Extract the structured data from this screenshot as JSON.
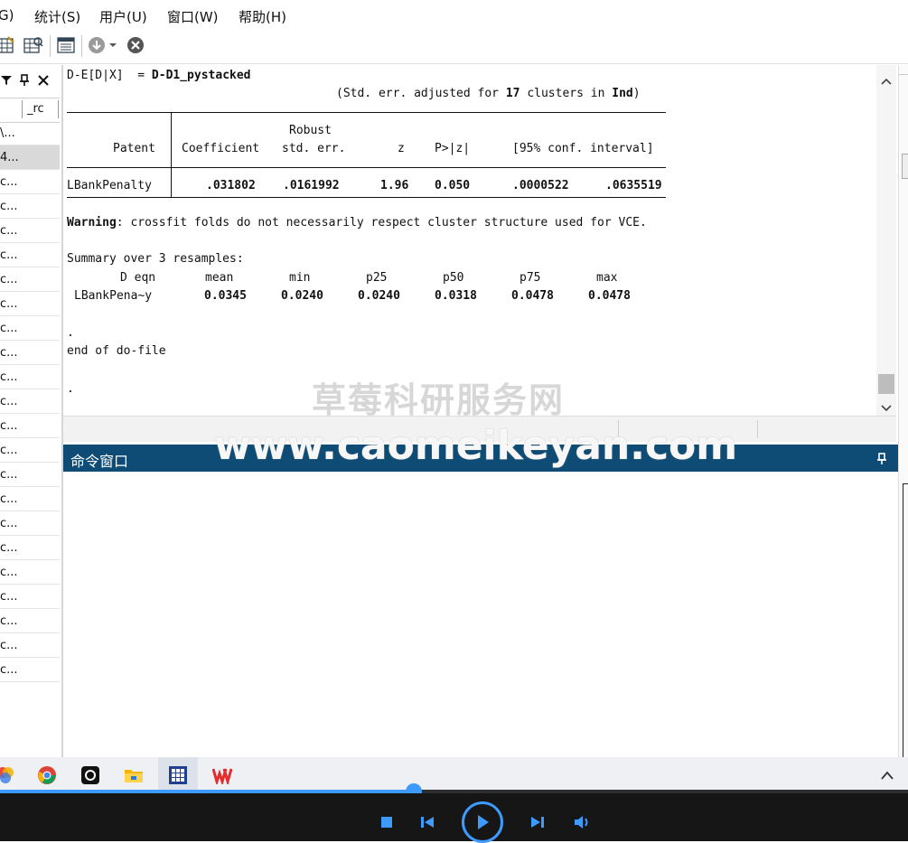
{
  "menu": {
    "items": [
      {
        "label": "G)"
      },
      {
        "label": "统计(S)"
      },
      {
        "label": "用户(U)"
      },
      {
        "label": "窗口(W)"
      },
      {
        "label": "帮助(H)"
      }
    ]
  },
  "variables_panel": {
    "column_header": "_rc",
    "rows": [
      "\\...",
      "4...",
      "c...",
      "c...",
      "c...",
      "c...",
      "c...",
      "c...",
      "c...",
      "c...",
      "c...",
      "c...",
      "c...",
      "c...",
      "c...",
      "c...",
      "c...",
      "c...",
      "c...",
      "c...",
      "c...",
      "c...",
      "c..."
    ]
  },
  "results": {
    "title_prefix": "D-E[D|X]  = ",
    "title_name": "D-D1_pystacked",
    "clusters_note_pre": "(Std. err. adjusted for ",
    "clusters_count": "17",
    "clusters_note_mid": " clusters in ",
    "clusters_var": "Ind",
    "clusters_note_post": ")",
    "table": {
      "header_top": "Robust",
      "depvar": "Patent",
      "columns": [
        "Coefficient",
        "std. err.",
        "z",
        "P>|z|",
        "[95% conf. interval]"
      ],
      "row_label": "LBankPenalty",
      "row_values": [
        ".031802",
        ".0161992",
        "1.96",
        "0.050",
        ".0000522",
        ".0635519"
      ]
    },
    "warning_label": "Warning",
    "warning_text": ": crossfit folds do not necessarily respect cluster structure used for VCE.",
    "summary_title": "Summary over 3 resamples:",
    "summary_headers": [
      "D eqn",
      "mean",
      "min",
      "p25",
      "p50",
      "p75",
      "max"
    ],
    "summary_label": "LBankPena~y",
    "summary_values": [
      "0.0345",
      "0.0240",
      "0.0240",
      "0.0318",
      "0.0478",
      "0.0478"
    ],
    "dot1": ".",
    "end_text": "end of do-file",
    "dot2": "."
  },
  "command_window": {
    "title": "命令窗口"
  },
  "watermark": {
    "line1": "草莓科研服务网",
    "line2": "www.caomeikeyan.com"
  },
  "player": {
    "progress": 0.456
  },
  "colors": {
    "command_header": "#0f4c75",
    "progress": "#3d9bff"
  }
}
